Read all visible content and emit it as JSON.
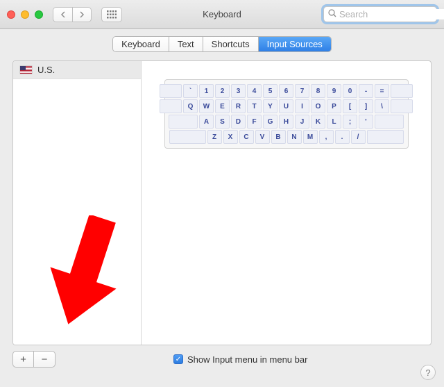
{
  "window": {
    "title": "Keyboard"
  },
  "search": {
    "placeholder": "Search",
    "value": ""
  },
  "tabs": [
    {
      "label": "Keyboard"
    },
    {
      "label": "Text"
    },
    {
      "label": "Shortcuts"
    },
    {
      "label": "Input Sources"
    }
  ],
  "active_tab_index": 3,
  "sources": [
    {
      "flag": "us",
      "name": "U.S."
    }
  ],
  "keyboard_rows": [
    [
      "`",
      "1",
      "2",
      "3",
      "4",
      "5",
      "6",
      "7",
      "8",
      "9",
      "0",
      "-",
      "="
    ],
    [
      "Q",
      "W",
      "E",
      "R",
      "T",
      "Y",
      "U",
      "I",
      "O",
      "P",
      "[",
      "]",
      "\\"
    ],
    [
      "A",
      "S",
      "D",
      "F",
      "G",
      "H",
      "J",
      "K",
      "L",
      ";",
      "'"
    ],
    [
      "Z",
      "X",
      "C",
      "V",
      "B",
      "N",
      "M",
      ",",
      ".",
      "/"
    ]
  ],
  "buttons": {
    "add": "+",
    "remove": "−"
  },
  "checkbox": {
    "show_input_menu": {
      "checked": true,
      "label": "Show Input menu in menu bar"
    }
  },
  "help_label": "?"
}
